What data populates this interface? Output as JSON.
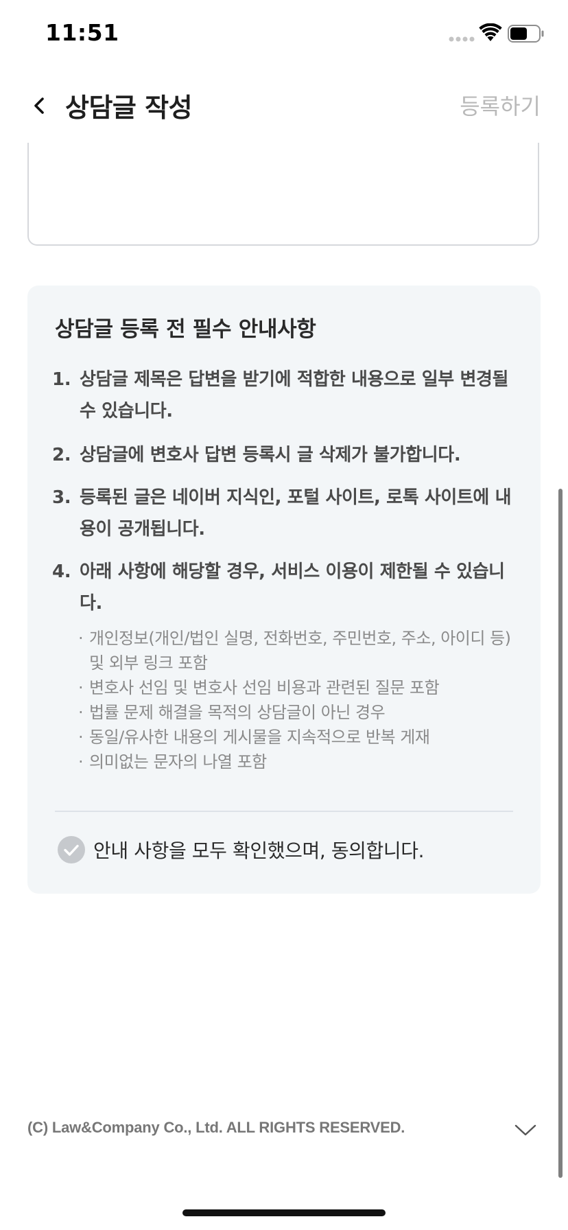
{
  "status_bar": {
    "time": "11:51"
  },
  "header": {
    "title": "상담글 작성",
    "submit_label": "등록하기"
  },
  "notice": {
    "title": "상담글 등록 전 필수 안내사항",
    "items": [
      {
        "num": "1.",
        "text": "상담글 제목은 답변을 받기에 적합한 내용으로 일부 변경될 수 있습니다."
      },
      {
        "num": "2.",
        "text": "상담글에 변호사 답변 등록시 글 삭제가 불가합니다."
      },
      {
        "num": "3.",
        "text": "등록된 글은 네이버 지식인, 포털 사이트, 로톡 사이트에 내용이 공개됩니다."
      },
      {
        "num": "4.",
        "text": "아래 사항에 해당할 경우, 서비스 이용이 제한될 수 있습니다."
      }
    ],
    "sub_items": [
      "개인정보(개인/법인 실명, 전화번호, 주민번호, 주소, 아이디 등) 및 외부 링크 포함",
      "변호사 선임 및 변호사 선임 비용과 관련된 질문 포함",
      "법률 문제 해결을 목적의 상담글이 아닌 경우",
      "동일/유사한 내용의 게시물을 지속적으로 반복 게재",
      "의미없는 문자의 나열 포함"
    ],
    "agree_label": "안내 사항을 모두 확인했으며, 동의합니다.",
    "agree_checked": false
  },
  "footer": {
    "copyright": "(C) Law&Company Co., Ltd. ALL RIGHTS RESERVED."
  },
  "colors": {
    "card_background": "#f3f6f8",
    "submit_disabled": "#b9b9b9",
    "check_inactive": "#c6c9cd"
  }
}
